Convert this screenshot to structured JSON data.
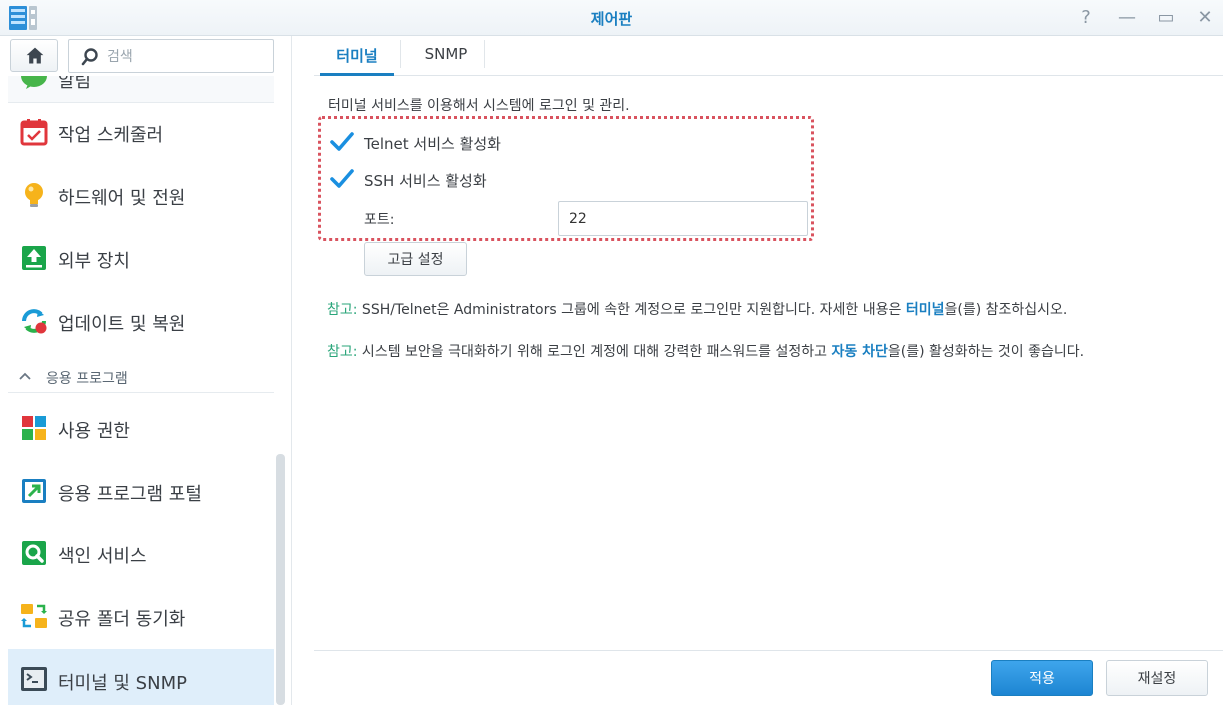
{
  "window": {
    "title": "제어판",
    "help_glyph": "?",
    "minimize_glyph": "—",
    "maximize_glyph": "▭",
    "close_glyph": "✕"
  },
  "sidebar": {
    "search_placeholder": "검색",
    "partial_item_label": "알림",
    "items": [
      {
        "label": "작업 스케줄러",
        "icon": "task-scheduler-icon"
      },
      {
        "label": "하드웨어 및 전원",
        "icon": "lightbulb-icon"
      },
      {
        "label": "외부 장치",
        "icon": "external-device-icon"
      },
      {
        "label": "업데이트 및 복원",
        "icon": "update-restore-icon"
      }
    ],
    "section_header": "응용 프로그램",
    "app_items": [
      {
        "label": "사용 권한",
        "icon": "privileges-icon"
      },
      {
        "label": "응용 프로그램 포털",
        "icon": "app-portal-icon"
      },
      {
        "label": "색인 서비스",
        "icon": "indexing-service-icon"
      },
      {
        "label": "공유 폴더 동기화",
        "icon": "shared-folder-sync-icon"
      },
      {
        "label": "터미널 및 SNMP",
        "icon": "terminal-icon",
        "active": true
      }
    ]
  },
  "tabs": [
    {
      "label": "터미널",
      "active": true
    },
    {
      "label": "SNMP",
      "active": false
    }
  ],
  "main": {
    "description": "터미널 서비스를 이용해서 시스템에 로그인 및 관리.",
    "telnet_label": "Telnet 서비스 활성화",
    "telnet_checked": true,
    "ssh_label": "SSH 서비스 활성화",
    "ssh_checked": true,
    "port_label": "포트:",
    "port_value": "22",
    "advanced_button": "고급 설정",
    "note1": {
      "prefix": "참고:",
      "text_before": " SSH/Telnet은 Administrators 그룹에 속한 계정으로 로그인만 지원합니다. 자세한 내용은 ",
      "link": "터미널",
      "text_after": "을(를) 참조하십시오."
    },
    "note2": {
      "prefix": "참고:",
      "text_before": " 시스템 보안을 극대화하기 위해 로그인 계정에 대해 강력한 패스워드를 설정하고 ",
      "link": "자동 차단",
      "text_after": "을(를) 활성화하는 것이 좋습니다."
    }
  },
  "footer": {
    "apply_button": "적용",
    "reset_button": "재설정"
  },
  "colors": {
    "accent": "#1a7fc1",
    "note_prefix": "#2aa57a",
    "highlight_border": "#d9535f",
    "active_nav_bg": "#dfeefa"
  }
}
